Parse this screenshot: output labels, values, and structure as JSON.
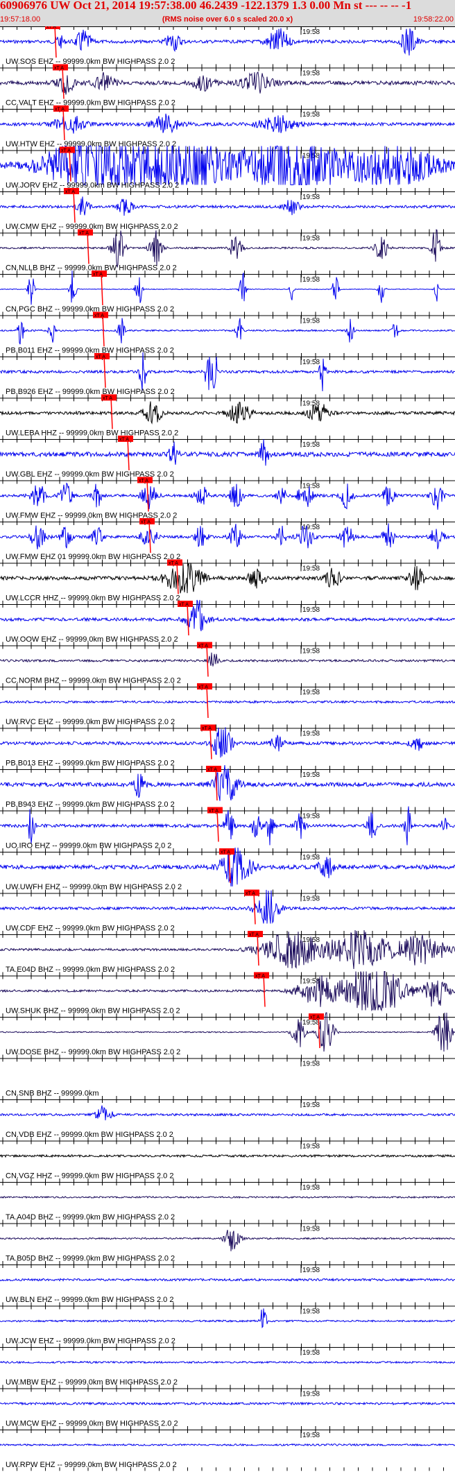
{
  "header": {
    "title": "60906976 UW Oct 21, 2014 19:57:38.00   46.2439 -122.1379  1.3 0.00 Mn st --- -- --  -1",
    "start_time": "19:57:18.00",
    "note": "(RMS noise over 6.0 s scaled 20.0 x)",
    "end_time": "19:58:22.00"
  },
  "colors": {
    "header_bg": "#dcdcdc",
    "title": "#e00000",
    "blue": "#0000ee",
    "navy": "#1a0a5a",
    "black": "#000000",
    "pick": "#ff0000"
  },
  "chart_data": {
    "type": "seismogram",
    "x_start": "19:57:18.00",
    "x_end": "19:58:22.00",
    "minute_label": "19:58",
    "pick_label": "xT A",
    "channels": [
      {
        "label": "UW.SOS EHZ -- 99999.0km BW  HIGHPASS  2.0  2",
        "color": "blue",
        "amp": 0.7,
        "pick": 79,
        "bursts": [
          [
            85,
            6,
            0.9
          ],
          [
            120,
            10,
            1.4
          ],
          [
            250,
            10,
            1.1
          ],
          [
            400,
            15,
            1.6
          ],
          [
            590,
            10,
            1.8
          ]
        ]
      },
      {
        "label": "CC.VALT EHZ -- 99999.0km BW  HIGHPASS  2.0  2",
        "color": "navy",
        "amp": 0.9,
        "pick": 90,
        "bursts": [
          [
            95,
            12,
            1.2
          ],
          [
            150,
            15,
            1.1
          ],
          [
            290,
            15,
            0.9
          ],
          [
            370,
            20,
            1.1
          ]
        ]
      },
      {
        "label": "UW.HTW EHZ -- 99999.0km BW  HIGHPASS  2.0  2",
        "color": "blue",
        "amp": 0.7,
        "pick": 91,
        "bursts": [
          [
            100,
            20,
            1.1
          ],
          [
            240,
            20,
            1.1
          ],
          [
            400,
            25,
            1.0
          ]
        ]
      },
      {
        "label": "UW.JORV EHZ -- 99999.0km BW  HIGHPASS  2.0  2",
        "color": "blue",
        "amp": 1.2,
        "pick": 100,
        "bursts": [
          [
            130,
            60,
            3.6
          ],
          [
            260,
            70,
            3.4
          ],
          [
            420,
            60,
            3.8
          ],
          [
            560,
            70,
            2.4
          ]
        ]
      },
      {
        "label": "UW.CMW EHZ -- 99999.0km BW  HIGHPASS  2.0  2",
        "color": "blue",
        "amp": 0.6,
        "pick": 106,
        "bursts": [
          [
            120,
            8,
            1.1
          ],
          [
            180,
            10,
            1.0
          ],
          [
            420,
            10,
            1.0
          ]
        ]
      },
      {
        "label": "CN.NLLB BHZ -- 99999.0km BW  HIGHPASS  2.0  2",
        "color": "navy",
        "amp": 0.4,
        "pick": 126,
        "bursts": [
          [
            170,
            8,
            2.6
          ],
          [
            225,
            8,
            2.2
          ],
          [
            340,
            8,
            1.6
          ],
          [
            550,
            8,
            1.8
          ],
          [
            628,
            6,
            2.4
          ]
        ]
      },
      {
        "label": "CN.PGC BHZ -- 99999.0km BW  HIGHPASS  2.0  2",
        "color": "blue",
        "amp": 0.15,
        "pick": 146,
        "bursts": [
          [
            45,
            4,
            2.2
          ],
          [
            105,
            4,
            2.4
          ],
          [
            200,
            4,
            2.4
          ],
          [
            350,
            4,
            2.4
          ],
          [
            420,
            3,
            1.6
          ],
          [
            483,
            4,
            2.4
          ],
          [
            550,
            4,
            2.2
          ],
          [
            630,
            3,
            1.6
          ]
        ]
      },
      {
        "label": "PB.B011 EHZ -- 99999.0km BW  HIGHPASS  2.0  2",
        "color": "blue",
        "amp": 0.35,
        "pick": 148,
        "bursts": [
          [
            30,
            4,
            1.8
          ],
          [
            75,
            4,
            1.6
          ],
          [
            175,
            4,
            1.8
          ],
          [
            345,
            4,
            1.8
          ],
          [
            505,
            4,
            1.6
          ],
          [
            570,
            4,
            1.2
          ]
        ]
      },
      {
        "label": "PB.B926 EHZ -- 99999.0km BW  HIGHPASS  2.0  2",
        "color": "blue",
        "amp": 0.6,
        "pick": 150,
        "bursts": [
          [
            205,
            4,
            3.6
          ],
          [
            300,
            4,
            3.6
          ],
          [
            310,
            3,
            3.2
          ],
          [
            465,
            4,
            2.4
          ]
        ]
      },
      {
        "label": "UW.LEBA HHZ -- 99999.0km BW  HIGHPASS  2.0  2",
        "color": "black",
        "amp": 0.7,
        "pick": 160,
        "bursts": [
          [
            220,
            12,
            1.3
          ],
          [
            345,
            15,
            1.4
          ],
          [
            460,
            15,
            1.1
          ]
        ]
      },
      {
        "label": "UW.GBL EHZ -- 99999.0km BW  HIGHPASS  2.0  2",
        "color": "blue",
        "amp": 1.0,
        "pick": 184,
        "bursts": [
          [
            250,
            6,
            1.6
          ],
          [
            380,
            6,
            1.6
          ]
        ]
      },
      {
        "label": "UW.FMW EHZ -- 99999.0km BW  HIGHPASS  2.0  2",
        "color": "blue",
        "amp": 0.6,
        "pick": 212,
        "bursts": [
          [
            55,
            10,
            1.5
          ],
          [
            95,
            8,
            1.4
          ],
          [
            140,
            6,
            1.5
          ],
          [
            215,
            10,
            1.5
          ],
          [
            290,
            8,
            1.4
          ],
          [
            340,
            8,
            1.5
          ],
          [
            405,
            6,
            1.5
          ],
          [
            440,
            10,
            1.5
          ],
          [
            500,
            8,
            1.5
          ],
          [
            560,
            8,
            1.5
          ],
          [
            630,
            8,
            1.6
          ]
        ]
      },
      {
        "label": "UW.FMW EHZ 01 99999.0km BW  HIGHPASS  2.0  2",
        "color": "blue",
        "amp": 0.6,
        "pick": 215,
        "bursts": [
          [
            55,
            10,
            1.5
          ],
          [
            95,
            8,
            1.4
          ],
          [
            140,
            6,
            1.5
          ],
          [
            215,
            10,
            1.5
          ],
          [
            290,
            8,
            1.4
          ],
          [
            340,
            8,
            1.5
          ],
          [
            405,
            6,
            1.5
          ],
          [
            440,
            10,
            1.5
          ],
          [
            500,
            8,
            1.5
          ],
          [
            560,
            8,
            1.5
          ],
          [
            630,
            8,
            1.6
          ]
        ]
      },
      {
        "label": "UW.LCCR HHZ -- 99999.0km BW  HIGHPASS  2.0  2",
        "color": "black",
        "amp": 0.8,
        "pick": 255,
        "bursts": [
          [
            265,
            25,
            2.0
          ],
          [
            370,
            10,
            1.4
          ],
          [
            480,
            10,
            1.2
          ],
          [
            600,
            10,
            1.4
          ]
        ]
      },
      {
        "label": "UW.OOW EHZ -- 99999.0km BW  HIGHPASS  2.0  2",
        "color": "blue",
        "amp": 0.7,
        "pick": 270,
        "bursts": [
          [
            283,
            5,
            3.4
          ],
          [
            283,
            15,
            1.4
          ]
        ]
      },
      {
        "label": "CC.NORM BHZ -- 99999.0km BW  HIGHPASS  2.0  2",
        "color": "navy",
        "amp": 0.5,
        "pick": 298,
        "bursts": [
          [
            308,
            5,
            2.0
          ]
        ]
      },
      {
        "label": "UW.RVC EHZ -- 99999.0km BW  HIGHPASS  2.0  2",
        "color": "blue",
        "amp": 0.5,
        "pick": 298,
        "bursts": []
      },
      {
        "label": "PB.B013 EHZ -- 99999.0km BW  HIGHPASS  2.0  2",
        "color": "blue",
        "amp": 0.7,
        "pick": 303,
        "bursts": [
          [
            320,
            12,
            2.4
          ],
          [
            400,
            8,
            1.4
          ],
          [
            600,
            8,
            1.2
          ]
        ]
      },
      {
        "label": "PB.B943 EHZ -- 99999.0km BW  HIGHPASS  2.0  2",
        "color": "blue",
        "amp": 0.9,
        "pick": 311,
        "bursts": [
          [
            325,
            15,
            2.4
          ],
          [
            200,
            8,
            1.4
          ]
        ]
      },
      {
        "label": "UO.IRO EHZ -- 99999.0km BW  HIGHPASS  2.0  2",
        "color": "blue",
        "amp": 0.7,
        "pick": 313,
        "bursts": [
          [
            45,
            4,
            2.6
          ],
          [
            330,
            6,
            2.0
          ],
          [
            370,
            6,
            2.2
          ],
          [
            390,
            4,
            3.2
          ],
          [
            432,
            6,
            2.0
          ],
          [
            536,
            5,
            2.6
          ],
          [
            588,
            4,
            2.6
          ],
          [
            640,
            4,
            1.2
          ]
        ]
      },
      {
        "label": "UW.UWFH EHZ -- 99999.0km BW  HIGHPASS  2.0  2",
        "color": "blue",
        "amp": 0.9,
        "pick": 330,
        "bursts": [
          [
            340,
            20,
            2.6
          ],
          [
            470,
            10,
            1.3
          ]
        ]
      },
      {
        "label": "UW.CDF EHZ -- 99999.0km BW  HIGHPASS  2.0  2",
        "color": "blue",
        "amp": 0.6,
        "pick": 366,
        "bursts": [
          [
            385,
            15,
            2.4
          ]
        ]
      },
      {
        "label": "TA.E04D BHZ -- 99999.0km BW  HIGHPASS  2.0  2",
        "color": "navy",
        "amp": 0.5,
        "pick": 371,
        "bursts": [
          [
            420,
            40,
            2.2
          ],
          [
            520,
            40,
            2.6
          ],
          [
            610,
            30,
            2.0
          ]
        ]
      },
      {
        "label": "UW.SHUK BHZ -- 99999.0km BW  HIGHPASS  2.0  2",
        "color": "navy",
        "amp": 0.5,
        "pick": 380,
        "bursts": [
          [
            540,
            40,
            3.6
          ],
          [
            460,
            30,
            1.8
          ],
          [
            630,
            15,
            2.4
          ]
        ]
      },
      {
        "label": "UW.DOSE BHZ -- 99999.0km BW  HIGHPASS  2.0  2",
        "color": "navy",
        "amp": 0.25,
        "pick": 459,
        "bursts": [
          [
            430,
            8,
            2.0
          ],
          [
            470,
            10,
            2.8
          ],
          [
            640,
            10,
            3.2
          ]
        ]
      },
      {
        "label": "CN.SNB BHZ -- 99999.0km",
        "color": "blue",
        "amp": 0.0,
        "pick": null,
        "bursts": []
      },
      {
        "label": "CN.VDB EHZ -- 99999.0km BW  HIGHPASS  2.0  2",
        "color": "blue",
        "amp": 0.5,
        "pick": null,
        "bursts": [
          [
            150,
            10,
            1.2
          ]
        ]
      },
      {
        "label": "CN.VGZ HHZ -- 99999.0km BW  HIGHPASS  2.0  2",
        "color": "black",
        "amp": 0.5,
        "pick": null,
        "bursts": []
      },
      {
        "label": "TA.A04D BHZ -- 99999.0km BW  HIGHPASS  2.0  2",
        "color": "navy",
        "amp": 0.35,
        "pick": null,
        "bursts": []
      },
      {
        "label": "TA.B05D BHZ -- 99999.0km BW  HIGHPASS  2.0  2",
        "color": "navy",
        "amp": 0.35,
        "pick": null,
        "bursts": [
          [
            335,
            10,
            1.6
          ]
        ]
      },
      {
        "label": "UW.BLN EHZ -- 99999.0km BW  HIGHPASS  2.0  2",
        "color": "blue",
        "amp": 0.5,
        "pick": null,
        "bursts": []
      },
      {
        "label": "UW.JCW EHZ -- 99999.0km BW  HIGHPASS  2.0  2",
        "color": "blue",
        "amp": 0.4,
        "pick": null,
        "bursts": [
          [
            380,
            4,
            2.8
          ]
        ]
      },
      {
        "label": "UW.MBW EHZ -- 99999.0km BW  HIGHPASS  2.0  2",
        "color": "blue",
        "amp": 0.4,
        "pick": null,
        "bursts": []
      },
      {
        "label": "UW.MCW EHZ -- 99999.0km BW  HIGHPASS  2.0  2",
        "color": "blue",
        "amp": 0.5,
        "pick": null,
        "bursts": []
      },
      {
        "label": "UW.RPW EHZ -- 99999.0km BW  HIGHPASS  2.0  2",
        "color": "blue",
        "amp": 0.4,
        "pick": null,
        "bursts": []
      }
    ]
  }
}
